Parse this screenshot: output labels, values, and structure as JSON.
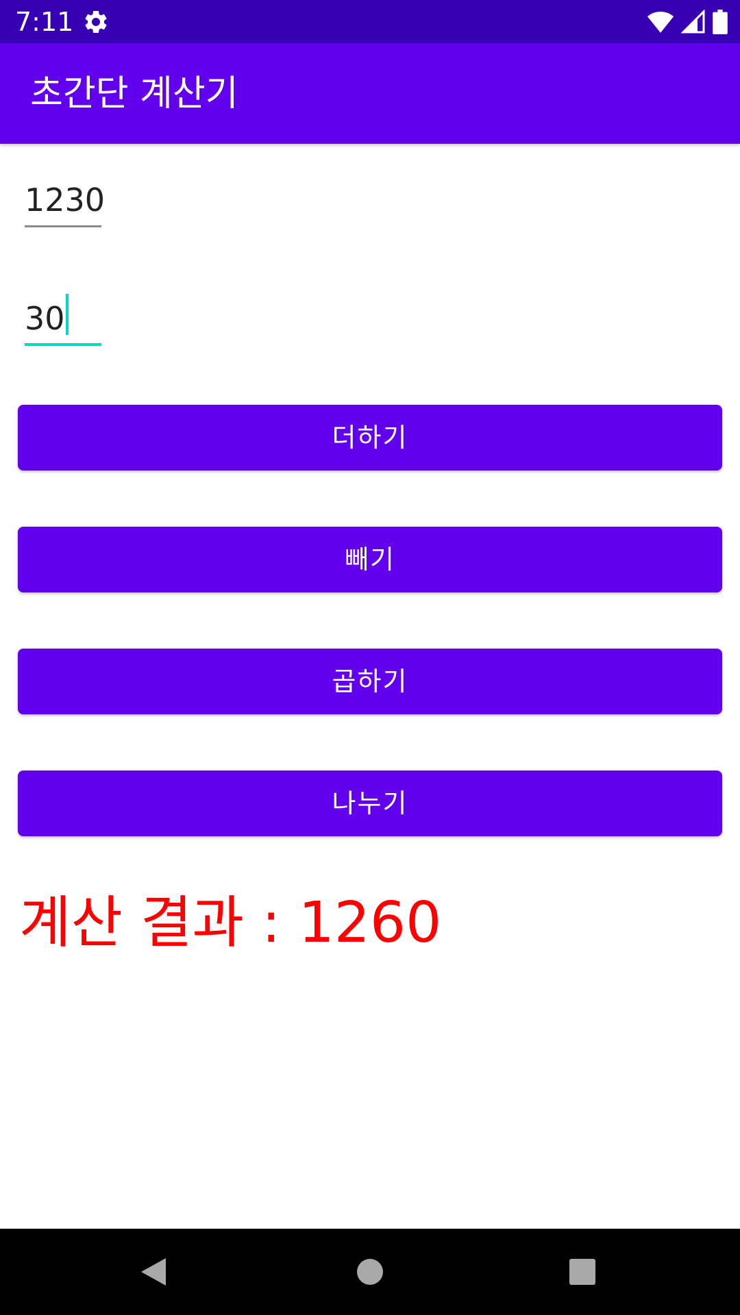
{
  "status_bar": {
    "time": "7:11",
    "background_color": "#3700B3",
    "icons": [
      "gear-icon",
      "wifi-icon",
      "cell-signal-icon",
      "battery-icon"
    ]
  },
  "app_bar": {
    "title": "초간단 계산기",
    "background_color": "#6200EE"
  },
  "inputs": {
    "first_value": "1230",
    "second_value": "30",
    "focused": "second"
  },
  "buttons": {
    "add": "더하기",
    "subtract": "빼기",
    "multiply": "곱하기",
    "divide": "나누기",
    "color": "#6200EE"
  },
  "result": {
    "text": "계산 결과 : 1260",
    "color": "#FF0000"
  },
  "nav_bar": {
    "icons": [
      "back-icon",
      "home-icon",
      "recents-icon"
    ]
  }
}
